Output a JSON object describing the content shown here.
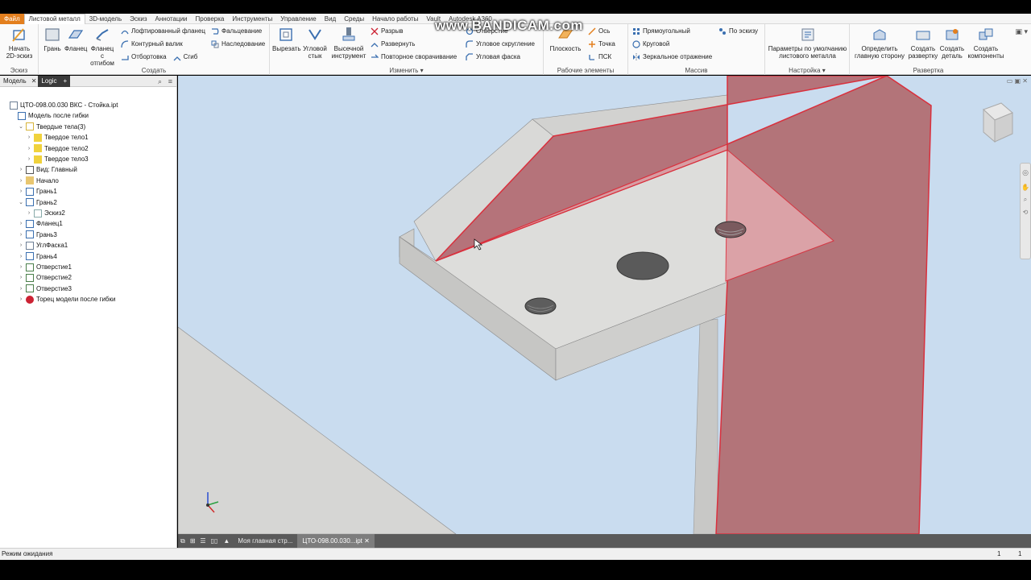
{
  "menu_tabs": [
    "Файл",
    "Листовой металл",
    "3D-модель",
    "Эскиз",
    "Аннотации",
    "Проверка",
    "Инструменты",
    "Управление",
    "Вид",
    "Среды",
    "Начало работы",
    "Vault",
    "Autodesk A360"
  ],
  "watermark": "www.BANDICAM.com",
  "ribbon": {
    "panels": {
      "sketch": "Эскиз",
      "create": "Создать",
      "modify": "Изменить",
      "work": "Рабочие элементы",
      "pattern": "Массив",
      "setup": "Настройка",
      "flat": "Развертка"
    },
    "start_sketch": "Начать 2D-эскиз",
    "face": "Грань",
    "flange": "Фланец",
    "flange_bend": "Фланец с отгибом",
    "lofted_flange": "Лофтированный фланец",
    "contour_roll": "Контурный валик",
    "hem_edge": "Отбортовка",
    "bend": "Сгиб",
    "hem": "Фальцевание",
    "inheritance": "Наследование",
    "cut": "Вырезать",
    "corner_seam": "Угловой стык",
    "punch_tool": "Высечной инструмент",
    "rip": "Разрыв",
    "unfold": "Развернуть",
    "refold": "Повторное сворачивание",
    "hole": "Отверстие",
    "corner_round": "Угловое скругление",
    "corner_chamfer": "Угловая фаска",
    "plane": "Плоскость",
    "axis": "Ось",
    "point": "Точка",
    "ucs": "ПСК",
    "rect_pattern": "Прямоугольный",
    "circ_pattern": "Круговой",
    "mirror": "Зеркальное отражение",
    "by_sketch": "По эскизу",
    "sm_defaults": "Параметры по умолчанию листового металла",
    "define_a_side": "Определить главную сторону",
    "create_flat": "Создать развертку",
    "create_part": "Создать деталь",
    "create_components": "Создать компоненты"
  },
  "sidebar": {
    "tab_model": "Модель",
    "tab_logic": "Logic",
    "tree": [
      {
        "label": "ЦТО-098.00.030 ВКС - Стойка.ipt",
        "indent": 0,
        "icon": "part-icon"
      },
      {
        "label": "Модель после гибки",
        "indent": 1,
        "icon": "folded-model-icon"
      },
      {
        "label": "Твердые тела(3)",
        "indent": 2,
        "icon": "solid-bodies-icon"
      },
      {
        "label": "Твердое тело1",
        "indent": 3,
        "icon": "solid-body-icon"
      },
      {
        "label": "Твердое тело2",
        "indent": 3,
        "icon": "solid-body-icon"
      },
      {
        "label": "Твердое тело3",
        "indent": 3,
        "icon": "solid-body-icon"
      },
      {
        "label": "Вид: Главный",
        "indent": 2,
        "icon": "view-icon"
      },
      {
        "label": "Начало",
        "indent": 2,
        "icon": "origin-folder-icon"
      },
      {
        "label": "Грань1",
        "indent": 2,
        "icon": "face-feature-icon"
      },
      {
        "label": "Грань2",
        "indent": 2,
        "icon": "face-feature-icon"
      },
      {
        "label": "Эскиз2",
        "indent": 3,
        "icon": "sketch-icon"
      },
      {
        "label": "Фланец1",
        "indent": 2,
        "icon": "flange-feature-icon"
      },
      {
        "label": "Грань3",
        "indent": 2,
        "icon": "face-feature-icon"
      },
      {
        "label": "УглФаска1",
        "indent": 2,
        "icon": "corner-chamfer-icon"
      },
      {
        "label": "Грань4",
        "indent": 2,
        "icon": "face-feature-icon"
      },
      {
        "label": "Отверстие1",
        "indent": 2,
        "icon": "hole-feature-icon"
      },
      {
        "label": "Отверстие2",
        "indent": 2,
        "icon": "hole-feature-icon"
      },
      {
        "label": "Отверстие3",
        "indent": 2,
        "icon": "hole-feature-icon"
      },
      {
        "label": "Торец модели после гибки",
        "indent": 2,
        "icon": "end-of-part-icon"
      }
    ]
  },
  "document_tabs": [
    "Моя главная стр...",
    "ЦТО-098.00.030...ipt"
  ],
  "status": {
    "text": "Режим ожидания",
    "count1": "1",
    "count2": "1"
  },
  "colors": {
    "accent": "#e37f1e",
    "selection": "#d9303d",
    "viewport_bg": "#c9dcef"
  }
}
